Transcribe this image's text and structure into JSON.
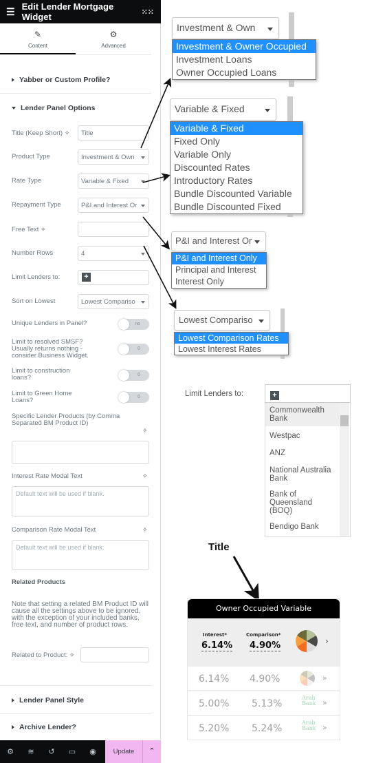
{
  "header": {
    "title": "Edit Lender Mortgage Widget",
    "menu_icon": "hamburger-icon",
    "apps_icon": "grid-icon"
  },
  "tabs": [
    {
      "label": "Content",
      "icon": "pencil-icon",
      "active": true
    },
    {
      "label": "Advanced",
      "icon": "gear-icon",
      "active": false
    }
  ],
  "sections": {
    "yabber": "Yabber or Custom Profile?",
    "options": "Lender Panel Options",
    "style": "Lender Panel Style",
    "archive": "Archive Lender?"
  },
  "fields": {
    "title": {
      "label": "Title (Keep Short)",
      "value": "Title"
    },
    "product_type": {
      "label": "Product Type",
      "value": "Investment & Own"
    },
    "rate_type": {
      "label": "Rate Type",
      "value": "Variable & Fixed"
    },
    "repayment_type": {
      "label": "Repayment Type",
      "value": "P&I and Interest Or"
    },
    "free_text": {
      "label": "Free Text",
      "value": ""
    },
    "number_rows": {
      "label": "Number Rows",
      "value": "4"
    },
    "limit_lenders": {
      "label": "Limit Lenders to:"
    },
    "sort": {
      "label": "Sort on Lowest",
      "value": "Lowest Compariso"
    },
    "unique": {
      "label": "Unique Lenders in Panel?",
      "value": "no"
    },
    "smsf": {
      "label": "Limit to resolved SMSF? Usually returns nothing - consider Business Widget.",
      "value": "0"
    },
    "construction": {
      "label": "Limit to construction loans?",
      "value": "0"
    },
    "green": {
      "label": "Limit to Green Home Loans?",
      "value": "0"
    },
    "specific": {
      "label": "Specific Lender Products (by Comma Separated BM Product ID)",
      "value": ""
    },
    "interest_modal": {
      "label": "Interest Rate Modal Text",
      "placeholder": "Default text will be used if blank."
    },
    "comparison_modal": {
      "label": "Comparison Rate Modal Text",
      "placeholder": "Default text will be used if blank."
    },
    "related_heading": "Related Products",
    "related_note": "Note that setting a related BM Product ID will cause all the settings above to be ignored, with the exception of your included banks, free text, and number of product rows.",
    "related": {
      "label": "Related to Product:",
      "value": ""
    }
  },
  "footer": {
    "update": "Update",
    "icons": [
      "settings-icon",
      "layers-icon",
      "history-icon",
      "responsive-icon",
      "eye-icon"
    ]
  },
  "accent": "#f2b6f0",
  "dropdowns": {
    "product_type": {
      "value": "Investment & Own",
      "options": [
        "Investment & Owner Occupied",
        "Investment Loans",
        "Owner Occupied Loans"
      ],
      "selected": 0
    },
    "rate_type": {
      "value": "Variable & Fixed",
      "options": [
        "Variable & Fixed",
        "Fixed Only",
        "Variable Only",
        "Discounted Rates",
        "Introductory Rates",
        "Bundle Discounted Variable",
        "Bundle Discounted Fixed"
      ],
      "selected": 0
    },
    "repayment": {
      "value": "P&I and Interest Or",
      "options": [
        "P&I and Interest Only",
        "Principal and Interest",
        "Interest Only"
      ],
      "selected": 0
    },
    "sort": {
      "value": "Lowest Compariso",
      "options": [
        "Lowest Comparison Rates",
        "Lowest Interest Rates"
      ],
      "selected": 0
    }
  },
  "lenders": {
    "label": "Limit Lenders to:",
    "options": [
      "Commonwealth Bank",
      "Westpac",
      "ANZ",
      "National Australia Bank",
      "Bank of Queensland (BOQ)",
      "Bendigo Bank"
    ]
  },
  "annotation": "Title",
  "widget": {
    "title": "Owner Occupied Variable",
    "interest_label": "Interest*",
    "comparison_label": "Comparison*",
    "interest": "6.14%",
    "comparison": "4.90%",
    "rows": [
      {
        "interest": "6.14%",
        "comparison": "4.90%",
        "logo": "pie"
      },
      {
        "interest": "5.00%",
        "comparison": "5.13%",
        "logo": "Arab Bank"
      },
      {
        "interest": "5.20%",
        "comparison": "5.24%",
        "logo": "Arab Bank"
      }
    ]
  }
}
